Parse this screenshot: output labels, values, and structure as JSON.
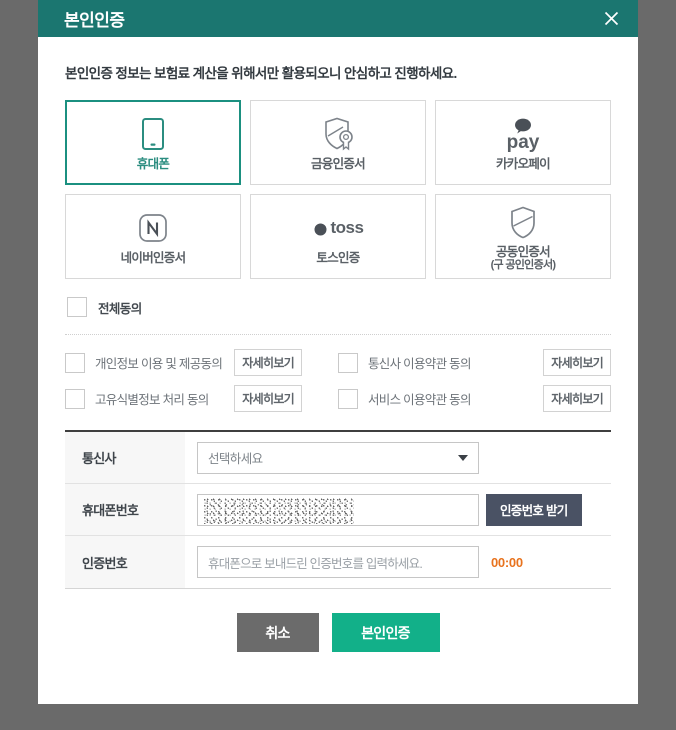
{
  "modal": {
    "title": "본인인증",
    "close_icon": "close-icon",
    "notice": "본인인증 정보는 보험료 계산을 위해서만 활용되오니 안심하고 진행하세요."
  },
  "auth_methods": [
    {
      "id": "mobile",
      "label": "휴대폰",
      "sub": "",
      "icon": "smartphone-icon",
      "selected": true
    },
    {
      "id": "finance-cert",
      "label": "금융인증서",
      "sub": "",
      "icon": "shield-certificate-icon",
      "selected": false
    },
    {
      "id": "kakaopay",
      "label": "카카오페이",
      "sub": "",
      "icon": "kakaopay-icon",
      "selected": false,
      "wordmark": "pay"
    },
    {
      "id": "naver-cert",
      "label": "네이버인증서",
      "sub": "",
      "icon": "naver-n-icon",
      "selected": false
    },
    {
      "id": "toss",
      "label": "토스인증",
      "sub": "",
      "icon": "toss-icon",
      "selected": false,
      "wordmark": "toss"
    },
    {
      "id": "joint-cert",
      "label": "공동인증서",
      "sub": "(구 공인인증서)",
      "icon": "shield-icon",
      "selected": false
    }
  ],
  "agreements": {
    "all_label": "전체동의",
    "all_checked": false,
    "items": [
      {
        "label": "개인정보 이용 및 제공동의",
        "detail_label": "자세히보기",
        "checked": false
      },
      {
        "label": "통신사 이용약관 동의",
        "detail_label": "자세히보기",
        "checked": false
      },
      {
        "label": "고유식별정보 처리 동의",
        "detail_label": "자세히보기",
        "checked": false
      },
      {
        "label": "서비스 이용약관 동의",
        "detail_label": "자세히보기",
        "checked": false
      }
    ]
  },
  "form": {
    "carrier": {
      "label": "통신사",
      "selected_option": "선택하세요",
      "options": [
        "선택하세요"
      ]
    },
    "phone": {
      "label": "휴대폰번호",
      "value": "",
      "redacted": true,
      "button_label": "인증번호 받기"
    },
    "auth_code": {
      "label": "인증번호",
      "value": "",
      "placeholder": "휴대폰으로 보내드린 인증번호를 입력하세요.",
      "timer": "00:00"
    }
  },
  "footer": {
    "cancel_label": "취소",
    "confirm_label": "본인인증"
  },
  "colors": {
    "header_teal": "#1b7670",
    "selected_border": "#1b9080",
    "confirm_green": "#12b089",
    "cancel_gray": "#6b6b6b",
    "code_button_slate": "#4a5264",
    "timer_orange": "#e8731e",
    "overlay_gray": "#6a6a6a"
  }
}
